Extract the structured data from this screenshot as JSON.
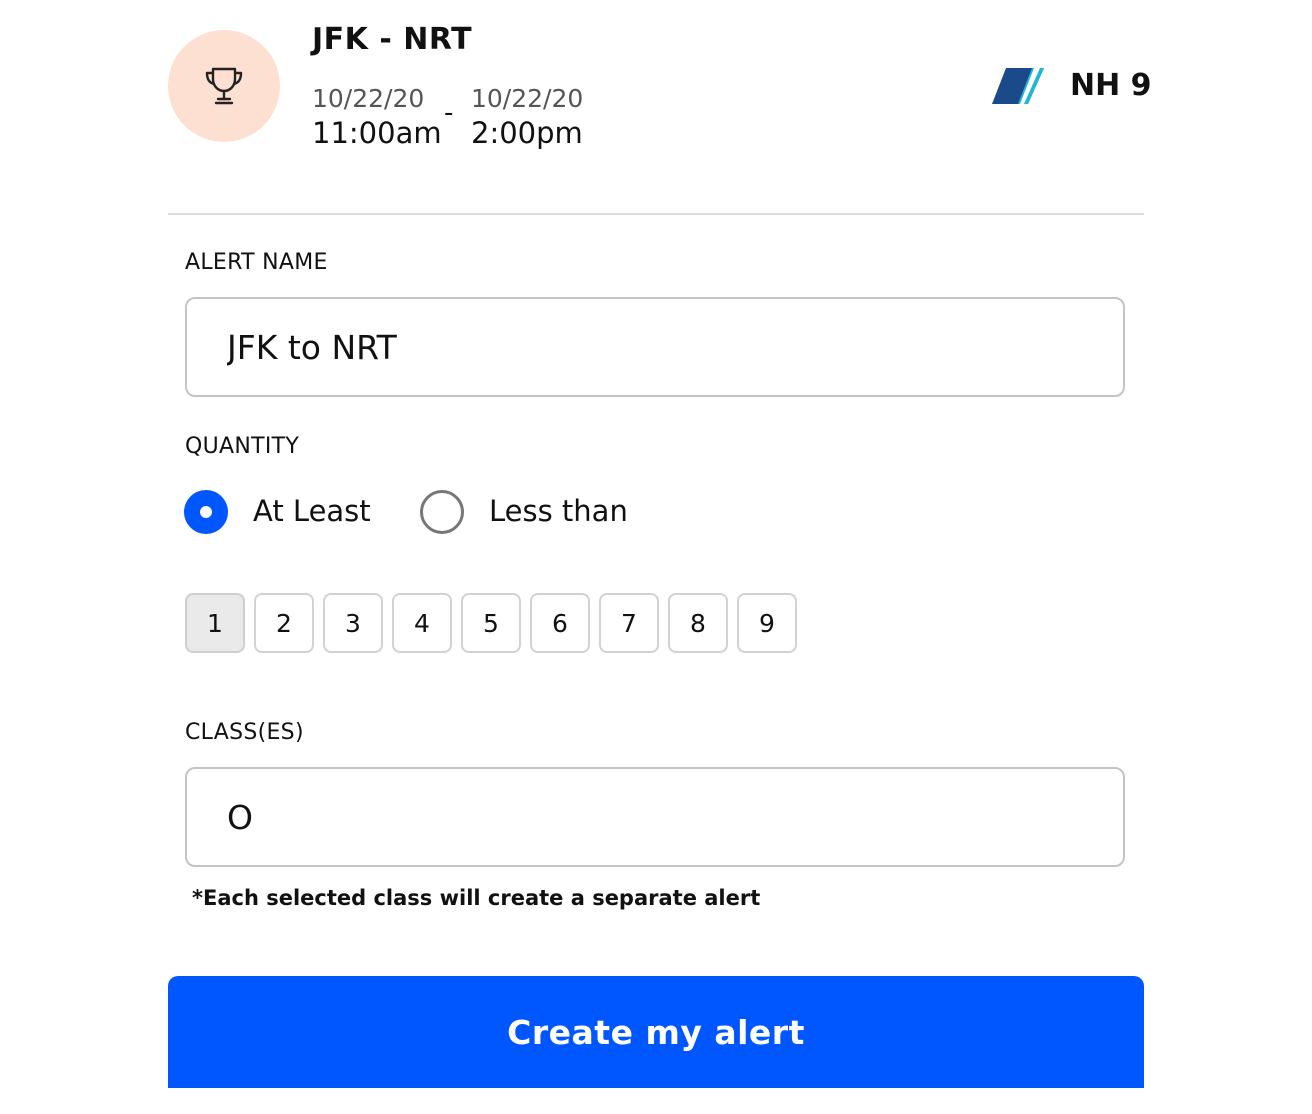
{
  "header": {
    "route": "JFK - NRT",
    "departure": {
      "date": "10/22/20",
      "time": "11:00am"
    },
    "separator": "-",
    "arrival": {
      "date": "10/22/20",
      "time": "2:00pm"
    },
    "flight_number": "NH 9",
    "trophy_icon": "trophy-icon",
    "airline_logo": "ana-airline-logo",
    "colors": {
      "trophy_bg": "#fde0d1",
      "logo_dark": "#1a4a8a",
      "logo_light": "#1fb7d8"
    }
  },
  "form": {
    "alert_name": {
      "label": "ALERT NAME",
      "value": "JFK to NRT"
    },
    "quantity": {
      "label": "QUANTITY",
      "options": [
        {
          "label": "At Least",
          "checked": true
        },
        {
          "label": "Less than",
          "checked": false
        }
      ],
      "numbers": [
        "1",
        "2",
        "3",
        "4",
        "5",
        "6",
        "7",
        "8",
        "9"
      ],
      "selected": "1"
    },
    "classes": {
      "label": "CLASS(ES)",
      "value": "O",
      "hint": "*Each selected class will create a separate alert"
    },
    "submit_label": "Create my alert"
  },
  "colors": {
    "primary": "#0057ff",
    "border": "#c4c4c4",
    "selected_bg": "#eaeaea"
  }
}
